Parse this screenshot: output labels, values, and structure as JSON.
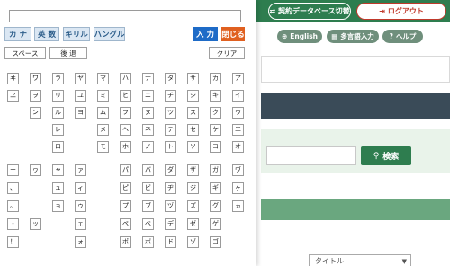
{
  "background": {
    "contract_db_label": "契約データベース切替",
    "logout_label": "ログアウト",
    "english_label": "English",
    "multilang_label": "多言語入力",
    "help_label": "ヘルプ",
    "search_label": "検索",
    "title_select_value": "タイトル"
  },
  "keyboard": {
    "modes": [
      "カ ナ",
      "英 数",
      "キリル",
      "ハングル"
    ],
    "input_label": "入 力",
    "close_label": "閉じる",
    "space_label": "スペース",
    "back_label": "後 退",
    "clear_label": "クリア",
    "upper_columns": [
      [
        "ア",
        "イ",
        "ウ",
        "エ",
        "オ"
      ],
      [
        "カ",
        "キ",
        "ク",
        "ケ",
        "コ"
      ],
      [
        "サ",
        "シ",
        "ス",
        "セ",
        "ソ"
      ],
      [
        "タ",
        "チ",
        "ツ",
        "テ",
        "ト"
      ],
      [
        "ナ",
        "ニ",
        "ヌ",
        "ネ",
        "ノ"
      ],
      [
        "ハ",
        "ヒ",
        "フ",
        "ヘ",
        "ホ"
      ],
      [
        "マ",
        "ミ",
        "ム",
        "メ",
        "モ"
      ],
      [
        "ヤ",
        "ユ",
        "ヨ",
        "",
        ""
      ],
      [
        "ラ",
        "リ",
        "ル",
        "レ",
        "ロ"
      ],
      [
        "ワ",
        "ヲ",
        "ン",
        "",
        ""
      ],
      [
        "ヰ",
        "ヱ",
        "",
        "",
        ""
      ]
    ],
    "lower_columns": [
      [
        "ヴ",
        "ヶ",
        "ヵ",
        "",
        ""
      ],
      [
        "ガ",
        "ギ",
        "グ",
        "ゲ",
        "ゴ"
      ],
      [
        "ザ",
        "ジ",
        "ズ",
        "ゼ",
        "ゾ"
      ],
      [
        "ダ",
        "ヂ",
        "ヅ",
        "デ",
        "ド"
      ],
      [
        "バ",
        "ビ",
        "ブ",
        "ベ",
        "ボ"
      ],
      [
        "パ",
        "ピ",
        "プ",
        "ペ",
        "ポ"
      ],
      [
        "",
        "",
        "",
        "",
        ""
      ],
      [
        "ァ",
        "ィ",
        "ゥ",
        "ェ",
        "ォ"
      ],
      [
        "ャ",
        "ュ",
        "ョ",
        "",
        ""
      ],
      [
        "ヮ",
        "",
        "",
        "ッ",
        ""
      ],
      [
        "ー",
        "、",
        "。",
        "・",
        "！"
      ]
    ]
  }
}
